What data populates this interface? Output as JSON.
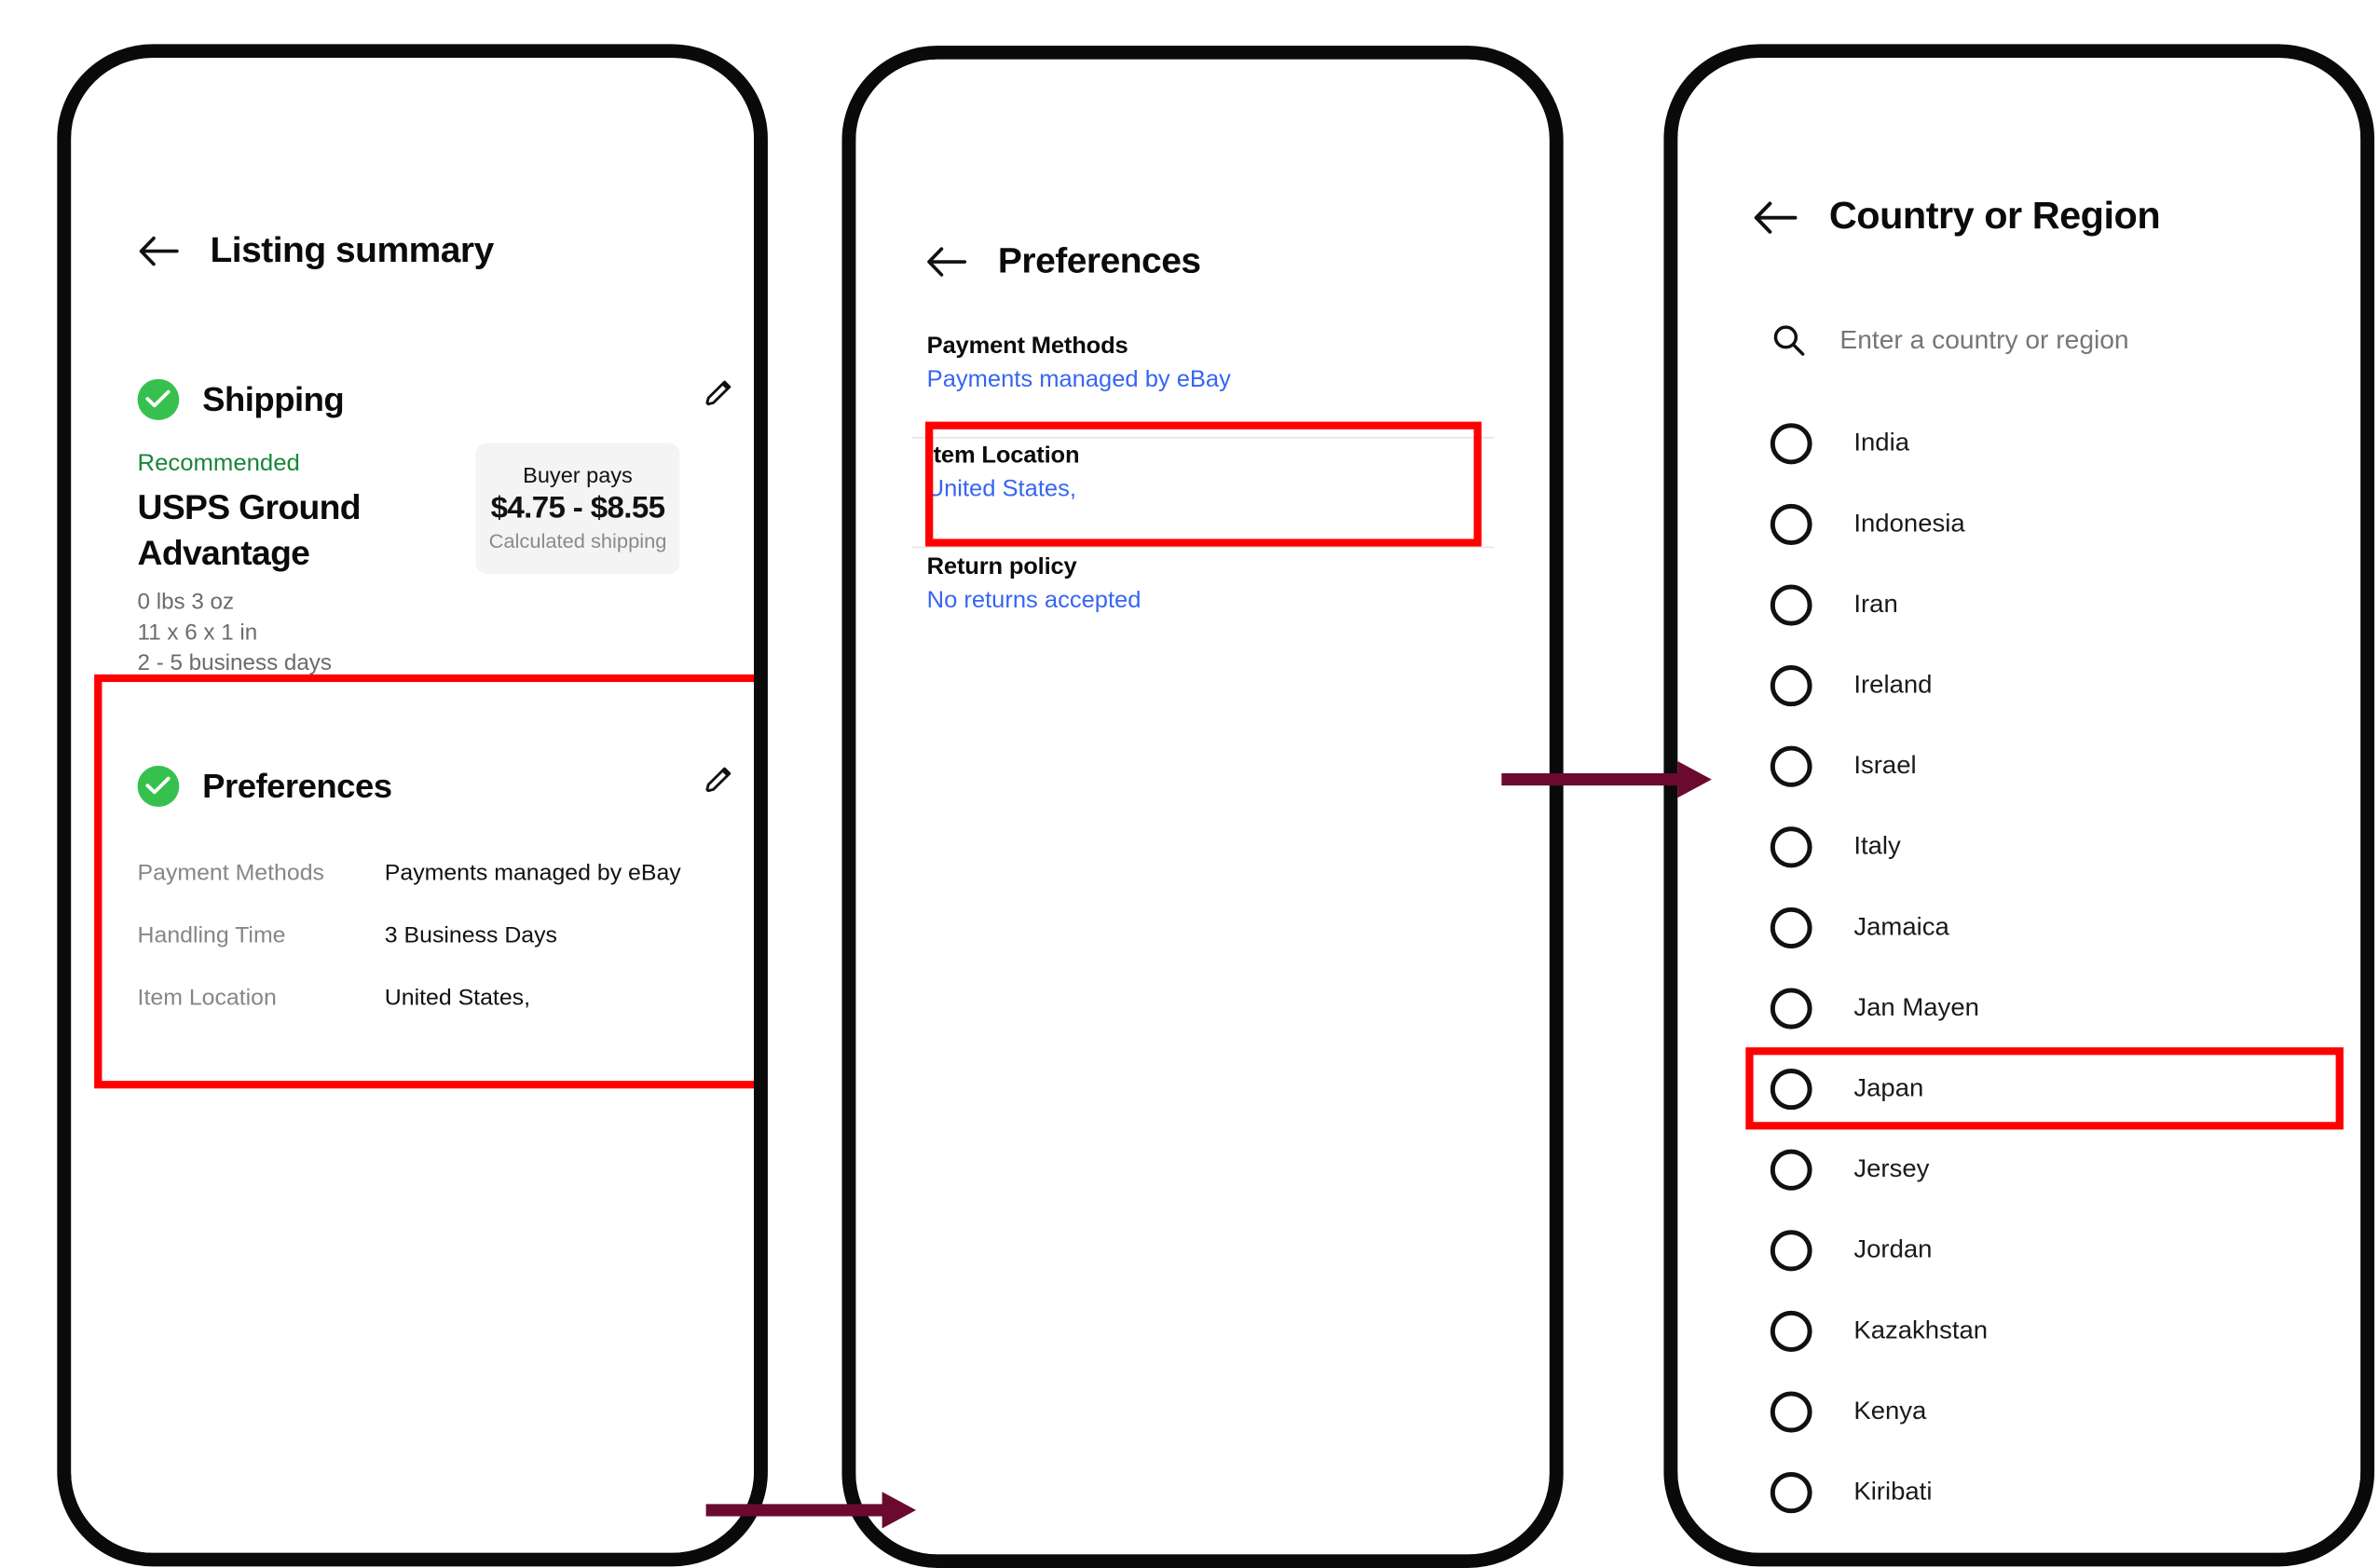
{
  "colors": {
    "accent_green": "#36C14E",
    "recommended_green": "#198639",
    "link_blue": "#3665F3",
    "highlight_red": "#FF0000",
    "arrow_maroon": "#6B0A2E",
    "muted_gray": "#868686"
  },
  "phone1": {
    "nav": {
      "back_icon": "back-arrow-icon",
      "title": "Listing summary"
    },
    "shipping": {
      "section_title": "Shipping",
      "status_icon": "check-circle-icon",
      "edit_icon": "pencil-icon",
      "recommended_label": "Recommended",
      "service_name": "USPS Ground Advantage",
      "weight": "0 lbs 3 oz",
      "dimensions": "11 x 6 x 1 in",
      "delivery_estimate": "2 - 5 business days",
      "buyer_card": {
        "label": "Buyer pays",
        "amount": "$4.75 - $8.55",
        "sub": "Calculated shipping"
      }
    },
    "preferences": {
      "section_title": "Preferences",
      "status_icon": "check-circle-icon",
      "edit_icon": "pencil-icon",
      "rows": [
        {
          "key": "Payment Methods",
          "value": "Payments managed by eBay"
        },
        {
          "key": "Handling Time",
          "value": "3 Business Days"
        },
        {
          "key": "Item Location",
          "value": "United States,"
        }
      ]
    }
  },
  "phone2": {
    "nav": {
      "back_icon": "back-arrow-icon",
      "title": "Preferences"
    },
    "rows": [
      {
        "label": "Payment Methods",
        "value": "Payments managed by eBay"
      },
      {
        "label": "Item Location",
        "value": "United States,"
      },
      {
        "label": "Return policy",
        "value": "No returns accepted"
      }
    ]
  },
  "phone3": {
    "nav": {
      "back_icon": "back-arrow-icon",
      "title": "Country or Region"
    },
    "search": {
      "icon": "search-icon",
      "placeholder": "Enter a country or region",
      "value": ""
    },
    "countries": [
      "India",
      "Indonesia",
      "Iran",
      "Ireland",
      "Israel",
      "Italy",
      "Jamaica",
      "Jan Mayen",
      "Japan",
      "Jersey",
      "Jordan",
      "Kazakhstan",
      "Kenya",
      "Kiribati"
    ],
    "highlighted_country": "Japan"
  },
  "annotations": {
    "boxes": [
      {
        "name": "preferences-section-highlight",
        "target": "phone1-preferences"
      },
      {
        "name": "item-location-highlight",
        "target": "phone2-item-location"
      },
      {
        "name": "japan-option-highlight",
        "target": "phone3-japan"
      }
    ],
    "arrows": [
      {
        "name": "arrow-phone1-to-phone2"
      },
      {
        "name": "arrow-phone2-to-phone3"
      }
    ]
  }
}
